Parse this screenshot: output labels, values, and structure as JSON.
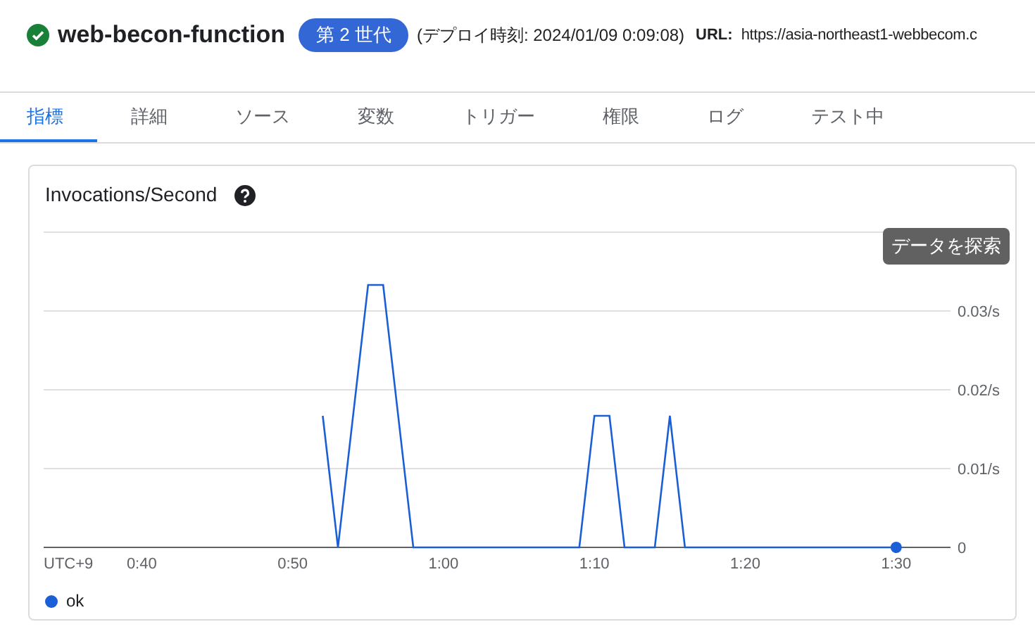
{
  "header": {
    "title": "web-becon-function",
    "healthy": true,
    "badge": "第 2 世代",
    "deploy_time": "(デプロイ時刻: 2024/01/09 0:09:08)",
    "url_label": "URL:",
    "url": "https://asia-northeast1-webbecom.c"
  },
  "tabs": [
    {
      "label": "指標",
      "selected": true
    },
    {
      "label": "詳細",
      "selected": false
    },
    {
      "label": "ソース",
      "selected": false
    },
    {
      "label": "変数",
      "selected": false
    },
    {
      "label": "トリガー",
      "selected": false
    },
    {
      "label": "権限",
      "selected": false
    },
    {
      "label": "ログ",
      "selected": false
    },
    {
      "label": "テスト中",
      "selected": false
    }
  ],
  "card": {
    "title": "Invocations/Second",
    "tooltip": "データを探索",
    "chart_data": {
      "type": "line",
      "xlabel": "UTC+9",
      "xlim": [
        33.5,
        93.6
      ],
      "ylim": [
        0,
        0.04
      ],
      "grid": true,
      "x": [
        52,
        53,
        55,
        56,
        58,
        69,
        70,
        71,
        72,
        74,
        75,
        76,
        90
      ],
      "series": [
        {
          "name": "ok",
          "color": "#1a5fd6",
          "values": [
            0.0167,
            0,
            0.0333,
            0.0333,
            0,
            0,
            0.0167,
            0.0167,
            0,
            0,
            0.0167,
            0,
            0
          ]
        }
      ],
      "xticks": [
        {
          "value": 40,
          "label": "0:40"
        },
        {
          "value": 50,
          "label": "0:50"
        },
        {
          "value": 60,
          "label": "1:00"
        },
        {
          "value": 70,
          "label": "1:10"
        },
        {
          "value": 80,
          "label": "1:20"
        },
        {
          "value": 90,
          "label": "1:30"
        }
      ],
      "yticks": [
        {
          "value": 0,
          "label": "0"
        },
        {
          "value": 0.01,
          "label": "0.01/s"
        },
        {
          "value": 0.02,
          "label": "0.02/s"
        },
        {
          "value": 0.03,
          "label": "0.03/s"
        }
      ]
    }
  }
}
